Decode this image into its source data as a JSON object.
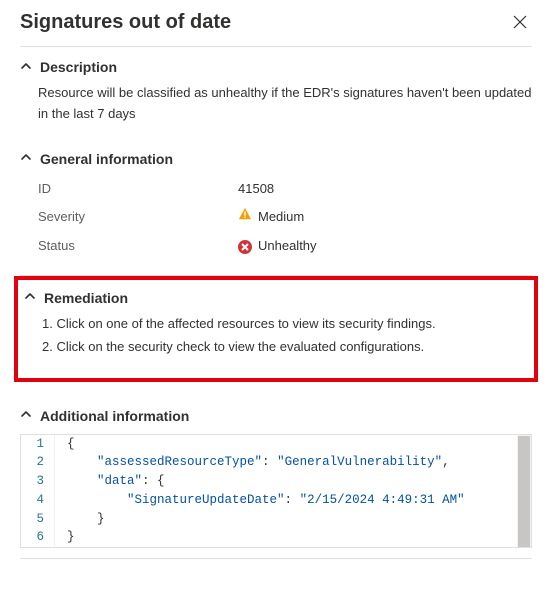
{
  "header": {
    "title": "Signatures out of date"
  },
  "sections": {
    "description": {
      "title": "Description",
      "text": "Resource will be classified as unhealthy if the EDR's signatures haven't been updated in the last 7 days"
    },
    "general": {
      "title": "General information",
      "rows": {
        "idLabel": "ID",
        "idValue": "41508",
        "severityLabel": "Severity",
        "severityValue": "Medium",
        "statusLabel": "Status",
        "statusValue": "Unhealthy"
      }
    },
    "remediation": {
      "title": "Remediation",
      "steps": {
        "s1": "1. Click on one of the affected resources to view its security findings.",
        "s2": "2. Click on the security check to view the evaluated configurations."
      }
    },
    "additional": {
      "title": "Additional information",
      "json": {
        "l1": "{",
        "l2k": "\"assessedResourceType\"",
        "l2v": "\"GeneralVulnerability\"",
        "l3k": "\"data\"",
        "l4k": "\"SignatureUpdateDate\"",
        "l4v": "\"2/15/2024 4:49:31 AM\"",
        "l6": "}"
      },
      "ln": {
        "n1": "1",
        "n2": "2",
        "n3": "3",
        "n4": "4",
        "n5": "5",
        "n6": "6"
      }
    }
  }
}
